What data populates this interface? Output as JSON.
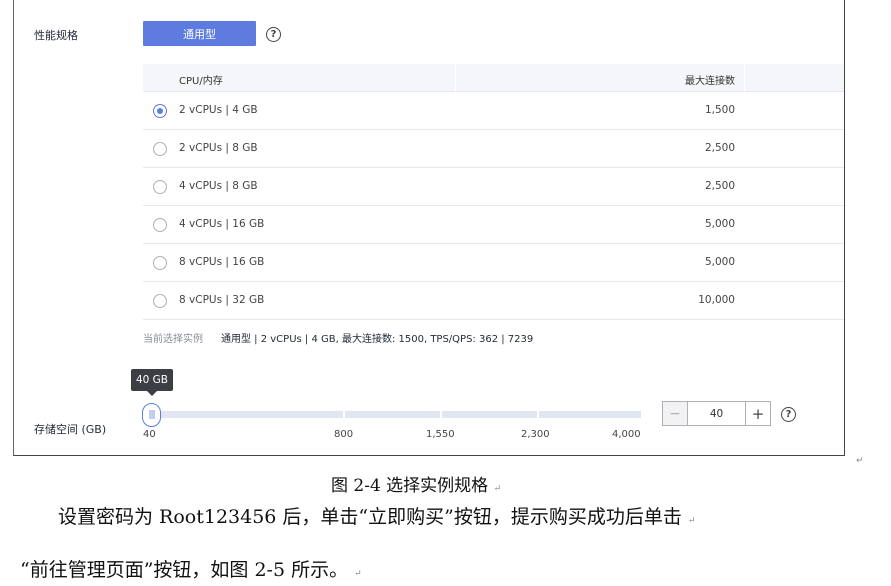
{
  "form": {
    "performance_label": "性能规格",
    "flavor_button": "通用型",
    "help_glyph": "?",
    "table": {
      "headers": [
        "CPU/内存",
        "最大连接数"
      ],
      "rows": [
        {
          "spec": "2 vCPUs | 4 GB",
          "max_conn": "1,500",
          "selected": true
        },
        {
          "spec": "2 vCPUs | 8 GB",
          "max_conn": "2,500",
          "selected": false
        },
        {
          "spec": "4 vCPUs | 8 GB",
          "max_conn": "2,500",
          "selected": false
        },
        {
          "spec": "4 vCPUs | 16 GB",
          "max_conn": "5,000",
          "selected": false
        },
        {
          "spec": "8 vCPUs | 16 GB",
          "max_conn": "5,000",
          "selected": false
        },
        {
          "spec": "8 vCPUs | 32 GB",
          "max_conn": "10,000",
          "selected": false
        }
      ]
    },
    "selected_label": "当前选择实例",
    "selected_value": "通用型 | 2 vCPUs | 4 GB, 最大连接数: 1500, TPS/QPS: 362 | 7239",
    "storage": {
      "label": "存储空间 (GB)",
      "tooltip": "40 GB",
      "handle_glyph": "|||",
      "ticks": [
        "40",
        "800",
        "1,550",
        "2,300",
        "4,000"
      ],
      "value": "40",
      "minus": "−",
      "plus": "+"
    }
  },
  "doc": {
    "caption": "图  2-4 选择实例规格",
    "line1": "设置密码为  Root123456 后，单击“立即购买”按钮，提示购买成功后单击",
    "line2": "“前往管理页面”按钮，如图  2-5 所示。",
    "para_mark": "↵"
  },
  "colors": {
    "accent": "#5e7ce0",
    "tooltip_bg": "#3b3e45",
    "table_header_bg": "#f4f6fa",
    "track": "#e2e6f0"
  }
}
